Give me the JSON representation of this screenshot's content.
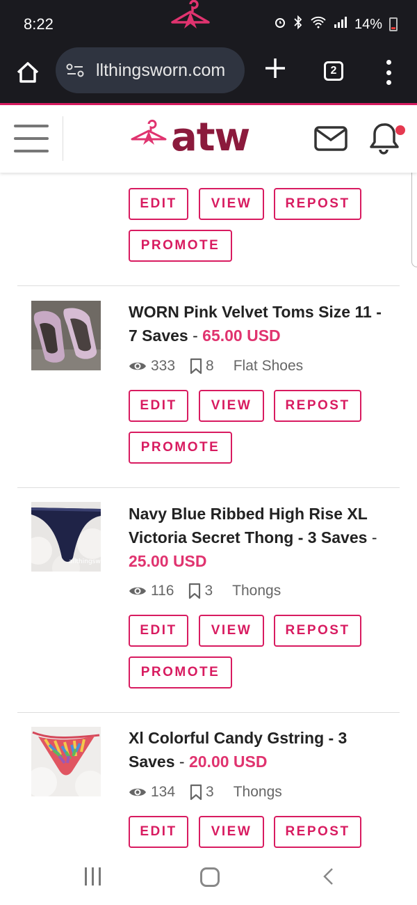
{
  "status_bar": {
    "time": "8:22",
    "battery": "14%"
  },
  "browser": {
    "url": "llthingsworn.com",
    "tab_count": "2"
  },
  "site": {
    "logo_text": "atw",
    "brand_color": "#d81b60"
  },
  "buttons": {
    "edit": "EDIT",
    "view": "VIEW",
    "repost": "REPOST",
    "promote": "PROMOTE"
  },
  "listings": [
    {
      "title": "WORN Pink Velvet Toms Size 11 - 7 Saves",
      "sep": " - ",
      "price": "65.00 USD",
      "views": "333",
      "saves": "8",
      "category": "Flat Shoes"
    },
    {
      "title": "Navy Blue Ribbed High Rise XL Victoria Secret Thong - 3 Saves",
      "sep": " - ",
      "price": "25.00 USD",
      "views": "116",
      "saves": "3",
      "category": "Thongs",
      "watermark": "allthingsw"
    },
    {
      "title": "Xl Colorful Candy Gstring - 3 Saves",
      "sep": " - ",
      "price": "20.00 USD",
      "views": "134",
      "saves": "3",
      "category": "Thongs"
    }
  ]
}
